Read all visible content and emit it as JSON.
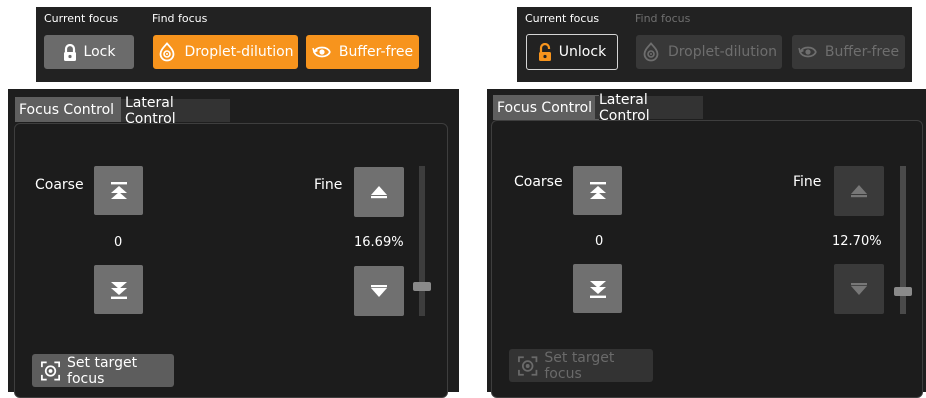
{
  "left": {
    "focus_bar": {
      "current_focus_label": "Current focus",
      "find_focus_label": "Find focus",
      "lock_button": "Lock",
      "droplet_button": "Droplet-dilution",
      "buffer_button": "Buffer-free"
    },
    "panel": {
      "tabs": [
        "Focus Control",
        "Lateral Control"
      ],
      "coarse_label": "Coarse",
      "coarse_value": "0",
      "fine_label": "Fine",
      "fine_value": "16.69%",
      "fine_slider_level": 0.17,
      "set_target_label": "Set target focus"
    }
  },
  "right": {
    "focus_bar": {
      "current_focus_label": "Current focus",
      "find_focus_label": "Find focus",
      "unlock_button": "Unlock",
      "droplet_button": "Droplet-dilution",
      "buffer_button": "Buffer-free"
    },
    "panel": {
      "tabs": [
        "Focus Control",
        "Lateral Control"
      ],
      "coarse_label": "Coarse",
      "coarse_value": "0",
      "fine_label": "Fine",
      "fine_value": "12.70%",
      "fine_slider_level": 0.13,
      "set_target_label": "Set target focus"
    }
  },
  "colors": {
    "accent_orange": "#f7941d",
    "panel_bg": "#1e1e1e",
    "button_grey": "#707070",
    "disabled_grey": "#3a3a3a"
  }
}
